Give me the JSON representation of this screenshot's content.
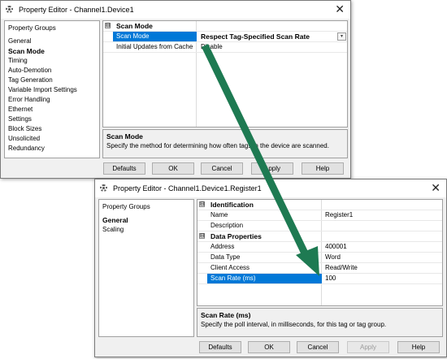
{
  "window1": {
    "title": "Property Editor - Channel1.Device1",
    "close_glyph": "✕",
    "groups_header": "Property Groups",
    "groups": [
      "General",
      "Scan Mode",
      "Timing",
      "Auto-Demotion",
      "Tag Generation",
      "Variable Import Settings",
      "Error Handling",
      "Ethernet",
      "Settings",
      "Block Sizes",
      "Unsolicited",
      "Redundancy"
    ],
    "selected_group": "Scan Mode",
    "category": {
      "toggle": "⊟",
      "label": "Scan Mode"
    },
    "rows": [
      {
        "name": "Scan Mode",
        "value": "Respect Tag-Specified Scan Rate"
      },
      {
        "name": "Initial Updates from Cache",
        "value": "Disable"
      }
    ],
    "description": {
      "title": "Scan Mode",
      "text": "Specify the method for determining how often tags in the device are scanned."
    },
    "buttons": {
      "defaults": "Defaults",
      "ok": "OK",
      "cancel": "Cancel",
      "apply": "Apply",
      "help": "Help"
    }
  },
  "window2": {
    "title": "Property Editor - Channel1.Device1.Register1",
    "close_glyph": "✕",
    "groups_header": "Property Groups",
    "groups": [
      "General",
      "Scaling"
    ],
    "selected_group": "General",
    "cat1": {
      "toggle": "⊟",
      "label": "Identification"
    },
    "ident_rows": [
      {
        "name": "Name",
        "value": "Register1"
      },
      {
        "name": "Description",
        "value": ""
      }
    ],
    "cat2": {
      "toggle": "⊟",
      "label": "Data Properties"
    },
    "data_rows": [
      {
        "name": "Address",
        "value": "400001"
      },
      {
        "name": "Data Type",
        "value": "Word"
      },
      {
        "name": "Client Access",
        "value": "Read/Write"
      },
      {
        "name": "Scan Rate (ms)",
        "value": "100"
      }
    ],
    "description": {
      "title": "Scan Rate (ms)",
      "text": "Specify the poll interval, in milliseconds, for this tag or tag group."
    },
    "buttons": {
      "defaults": "Defaults",
      "ok": "OK",
      "cancel": "Cancel",
      "apply": "Apply",
      "help": "Help"
    }
  },
  "colors": {
    "arrow": "#1e7a52",
    "selection": "#0078d7"
  }
}
